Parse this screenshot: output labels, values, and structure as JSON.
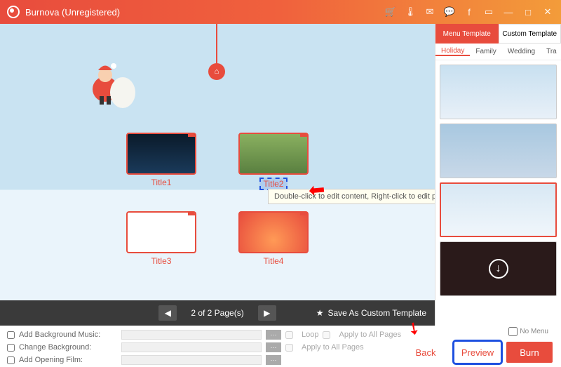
{
  "titlebar": {
    "title": "Burnova (Unregistered)"
  },
  "canvas": {
    "thumbs": [
      {
        "label": "Title1"
      },
      {
        "label": "Title2",
        "selected": true
      },
      {
        "label": "Title3"
      },
      {
        "label": "Title4"
      }
    ],
    "tooltip": "Double-click to edit content, Right-click to edit properties"
  },
  "pager": {
    "text": "2 of 2 Page(s)",
    "save_template": "Save As Custom Template"
  },
  "side": {
    "tabs": {
      "menu": "Menu Template",
      "custom": "Custom Template"
    },
    "cats": [
      "Holiday",
      "Family",
      "Wedding",
      "Tra"
    ]
  },
  "bottom": {
    "music_lbl": "Add Background Music:",
    "loop": "Loop",
    "apply": "Apply to All Pages",
    "bg_lbl": "Change Background:",
    "film_lbl": "Add Opening Film:",
    "nomenu": "No Menu"
  },
  "buttons": {
    "back": "Back",
    "preview": "Preview",
    "burn": "Burn"
  }
}
